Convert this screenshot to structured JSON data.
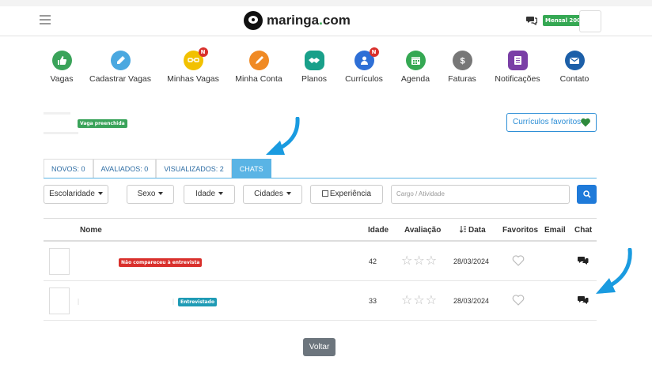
{
  "header": {
    "logo_text_main": "maringa",
    "logo_text_dot": ".",
    "logo_text_tld": "com",
    "plan_badge": "Mensal 200"
  },
  "menu": {
    "items": [
      {
        "label": "Vagas",
        "icon": "thumbs-up-icon",
        "color": "#3aa35a",
        "badge": ""
      },
      {
        "label": "Cadastrar Vagas",
        "icon": "pencil-icon",
        "color": "#4aa8e0",
        "badge": ""
      },
      {
        "label": "Minhas Vagas",
        "icon": "glasses-icon",
        "color": "#f2c100",
        "badge": "N"
      },
      {
        "label": "Minha Conta",
        "icon": "pen-icon",
        "color": "#f08a24",
        "badge": ""
      },
      {
        "label": "Planos",
        "icon": "handshake-icon",
        "color": "#19a08a",
        "badge": ""
      },
      {
        "label": "Currículos",
        "icon": "user-icon",
        "color": "#2e6fd6",
        "badge": "N"
      },
      {
        "label": "Agenda",
        "icon": "calendar-icon",
        "color": "#35a853",
        "badge": ""
      },
      {
        "label": "Faturas",
        "icon": "dollar-icon",
        "color": "#777777",
        "badge": ""
      },
      {
        "label": "Notificações",
        "icon": "document-icon",
        "color": "#7a3fa6",
        "badge": ""
      },
      {
        "label": "Contato",
        "icon": "envelope-icon",
        "color": "#1c5fa8",
        "badge": ""
      }
    ]
  },
  "vaga": {
    "status_tag": "Vaga preenchida",
    "favorites_button": "Currículos favoritos"
  },
  "tabs": [
    {
      "label": "NOVOS: 0",
      "active": false
    },
    {
      "label": "AVALIADOS: 0",
      "active": false
    },
    {
      "label": "VISUALIZADOS: 2",
      "active": false
    },
    {
      "label": "CHATS",
      "active": true
    }
  ],
  "filters": {
    "escolaridade": "Escolaridade",
    "sexo": "Sexo",
    "idade": "Idade",
    "cidades": "Cidades",
    "experiencia": "Experiência",
    "search_placeholder": "Cargo / Atividade"
  },
  "table": {
    "headers": {
      "nome": "Nome",
      "idade": "Idade",
      "avaliacao": "Avaliação",
      "data": "Data",
      "favoritos": "Favoritos",
      "email": "Email",
      "chat": "Chat"
    },
    "rows": [
      {
        "status": "Não compareceu à entrevista",
        "status_color": "#d9302c",
        "idade": "42",
        "rating": 0,
        "data": "28/03/2024"
      },
      {
        "status": "Entrevistado",
        "status_color": "#1f9bb5",
        "idade": "33",
        "rating": 0,
        "data": "28/03/2024"
      }
    ]
  },
  "footer": {
    "back_button": "Voltar"
  },
  "colors": {
    "accent": "#5ab4e5",
    "primary": "#1f7ad9",
    "arrow": "#1a9be0"
  }
}
